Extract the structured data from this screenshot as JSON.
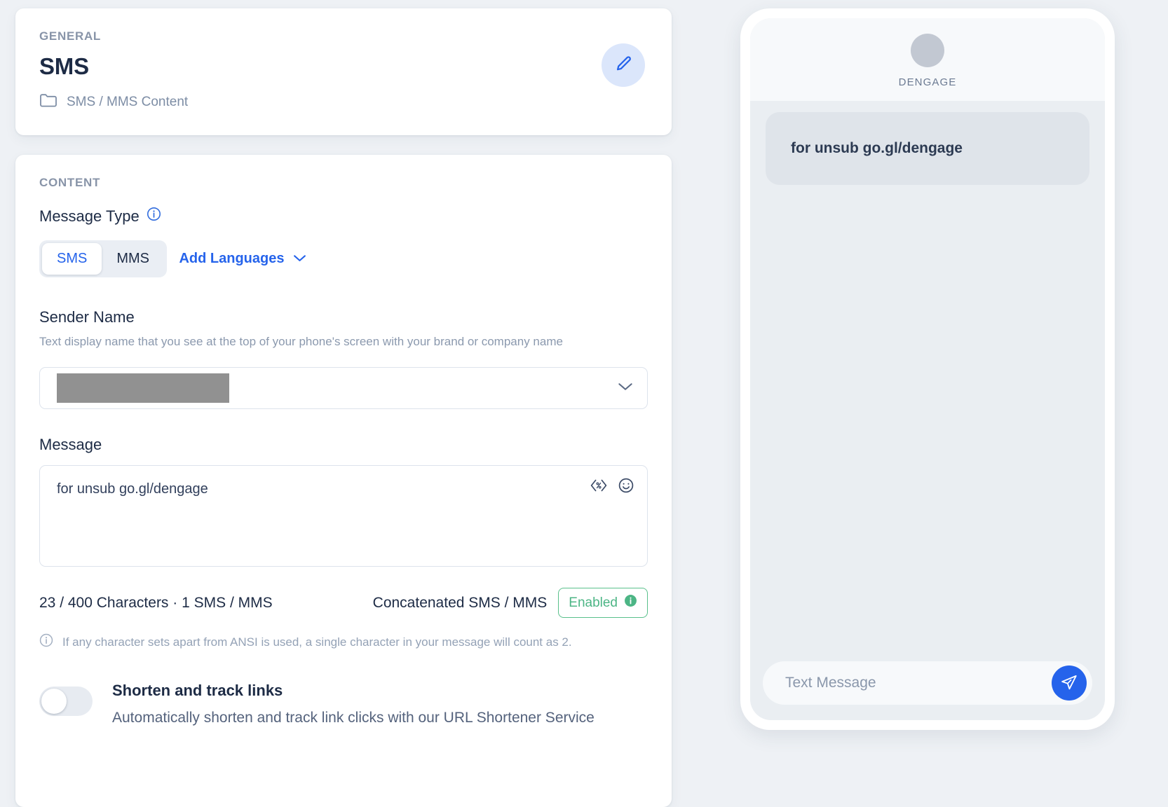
{
  "general": {
    "eyebrow": "GENERAL",
    "title": "SMS",
    "breadcrumb": "SMS / MMS Content",
    "edit_button_label": "Edit"
  },
  "content": {
    "eyebrow": "CONTENT",
    "message_type": {
      "label": "Message Type",
      "options": [
        "SMS",
        "MMS"
      ],
      "selected": "SMS"
    },
    "add_languages_label": "Add Languages",
    "sender_name": {
      "label": "Sender Name",
      "helper": "Text display name that you see at the top of your phone's screen with your brand or company name",
      "value": ""
    },
    "message": {
      "label": "Message",
      "value": "for unsub go.gl/dengage"
    },
    "counter": "23 / 400 Characters · 1 SMS / MMS",
    "concatenated": {
      "label": "Concatenated SMS / MMS",
      "status": "Enabled"
    },
    "ansi_note": "If any character sets apart from ANSI is used, a single character in your message will count as 2.",
    "shorten_links": {
      "title": "Shorten and track links",
      "description": "Automatically shorten and track link clicks with our URL Shortener Service",
      "enabled": false
    }
  },
  "preview": {
    "sender": "DENGAGE",
    "bubble_text": "for unsub go.gl/dengage",
    "input_placeholder": "Text Message"
  },
  "colors": {
    "accent_blue": "#2563eb",
    "success_green": "#4cb585",
    "page_bg": "#eef1f5"
  }
}
